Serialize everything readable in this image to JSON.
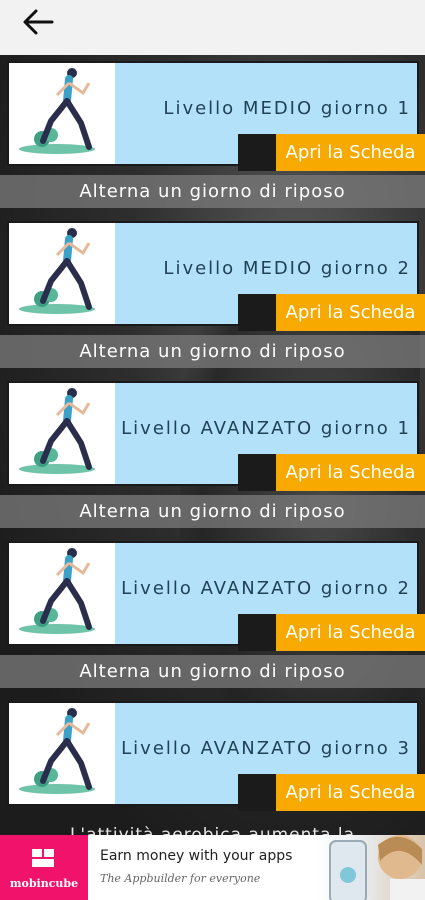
{
  "header": {
    "back_icon": "arrow-left-icon"
  },
  "workouts": [
    {
      "title": "Livello MEDIO giorno 1",
      "button_label": "Apri la Scheda",
      "note": "Alterna un giorno di riposo"
    },
    {
      "title": "Livello MEDIO giorno 2",
      "button_label": "Apri la Scheda",
      "note": "Alterna un giorno di riposo"
    },
    {
      "title": "Livello AVANZATO giorno 1",
      "button_label": "Apri la Scheda",
      "note": "Alterna un giorno di riposo"
    },
    {
      "title": "Livello AVANZATO giorno 2",
      "button_label": "Apri la Scheda",
      "note": "Alterna un giorno di riposo"
    },
    {
      "title": "Livello AVANZATO giorno 3",
      "button_label": "Apri la Scheda"
    }
  ],
  "footer_text": "L'attività aerobica aumenta la",
  "ad": {
    "brand": "mobincube",
    "headline": "Earn money with your apps",
    "tagline": "The Appbuilder for everyone"
  },
  "colors": {
    "topbar": "#f2f2f2",
    "panel": "#b3e1fa",
    "button": "#f7a900",
    "ad_brand": "#f0126b"
  }
}
